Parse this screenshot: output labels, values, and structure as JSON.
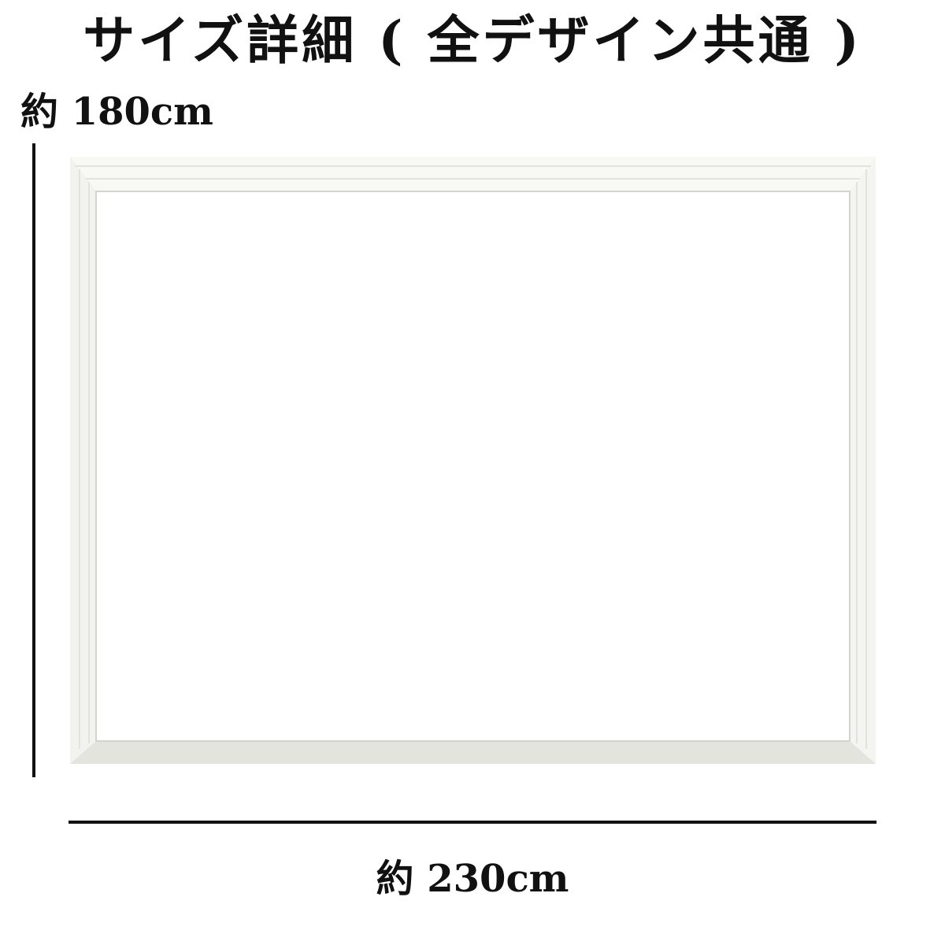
{
  "title": "サイズ詳細 ( 全デザイン共通 )",
  "dimensions": {
    "height_label": "約 180cm",
    "width_label": "約 230cm"
  },
  "colors": {
    "frame": "#f2f2ef",
    "frame_shadow": "#d9d9d3",
    "line": "#111111"
  }
}
